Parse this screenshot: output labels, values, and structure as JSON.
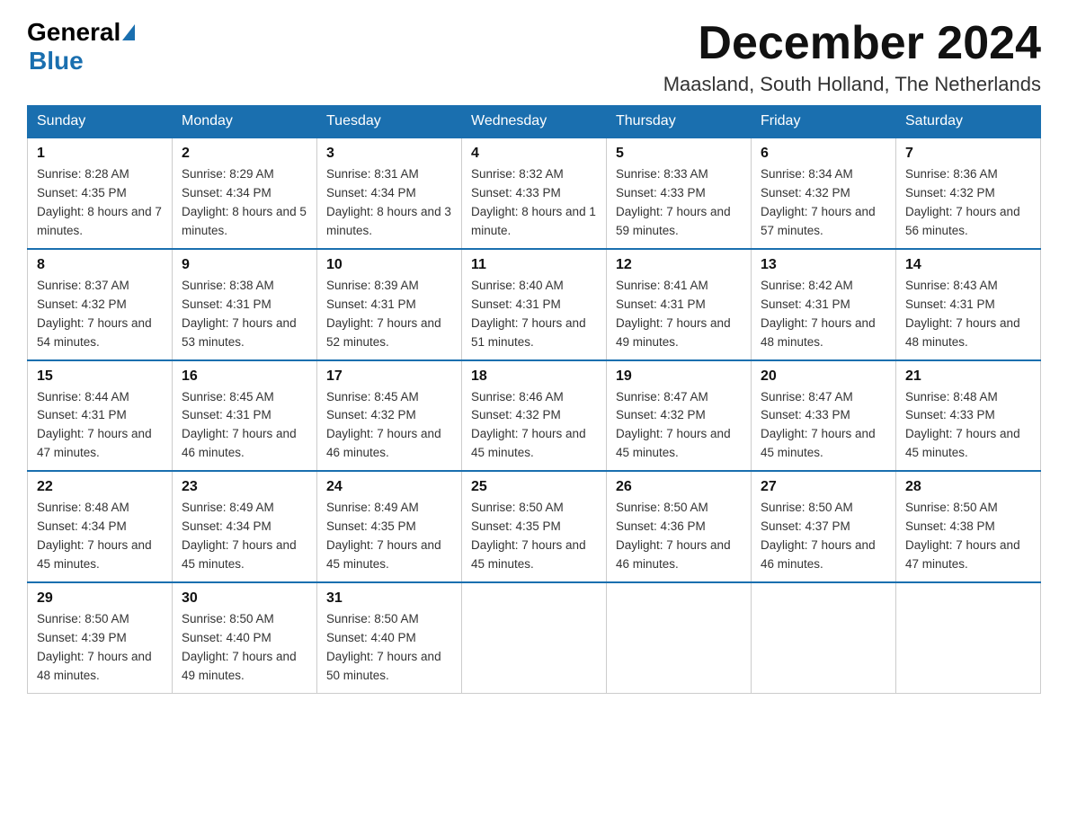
{
  "header": {
    "logo_general": "General",
    "logo_blue": "Blue",
    "month_year": "December 2024",
    "location": "Maasland, South Holland, The Netherlands"
  },
  "days_of_week": [
    "Sunday",
    "Monday",
    "Tuesday",
    "Wednesday",
    "Thursday",
    "Friday",
    "Saturday"
  ],
  "weeks": [
    [
      {
        "day": "1",
        "sunrise": "8:28 AM",
        "sunset": "4:35 PM",
        "daylight": "8 hours and 7 minutes."
      },
      {
        "day": "2",
        "sunrise": "8:29 AM",
        "sunset": "4:34 PM",
        "daylight": "8 hours and 5 minutes."
      },
      {
        "day": "3",
        "sunrise": "8:31 AM",
        "sunset": "4:34 PM",
        "daylight": "8 hours and 3 minutes."
      },
      {
        "day": "4",
        "sunrise": "8:32 AM",
        "sunset": "4:33 PM",
        "daylight": "8 hours and 1 minute."
      },
      {
        "day": "5",
        "sunrise": "8:33 AM",
        "sunset": "4:33 PM",
        "daylight": "7 hours and 59 minutes."
      },
      {
        "day": "6",
        "sunrise": "8:34 AM",
        "sunset": "4:32 PM",
        "daylight": "7 hours and 57 minutes."
      },
      {
        "day": "7",
        "sunrise": "8:36 AM",
        "sunset": "4:32 PM",
        "daylight": "7 hours and 56 minutes."
      }
    ],
    [
      {
        "day": "8",
        "sunrise": "8:37 AM",
        "sunset": "4:32 PM",
        "daylight": "7 hours and 54 minutes."
      },
      {
        "day": "9",
        "sunrise": "8:38 AM",
        "sunset": "4:31 PM",
        "daylight": "7 hours and 53 minutes."
      },
      {
        "day": "10",
        "sunrise": "8:39 AM",
        "sunset": "4:31 PM",
        "daylight": "7 hours and 52 minutes."
      },
      {
        "day": "11",
        "sunrise": "8:40 AM",
        "sunset": "4:31 PM",
        "daylight": "7 hours and 51 minutes."
      },
      {
        "day": "12",
        "sunrise": "8:41 AM",
        "sunset": "4:31 PM",
        "daylight": "7 hours and 49 minutes."
      },
      {
        "day": "13",
        "sunrise": "8:42 AM",
        "sunset": "4:31 PM",
        "daylight": "7 hours and 48 minutes."
      },
      {
        "day": "14",
        "sunrise": "8:43 AM",
        "sunset": "4:31 PM",
        "daylight": "7 hours and 48 minutes."
      }
    ],
    [
      {
        "day": "15",
        "sunrise": "8:44 AM",
        "sunset": "4:31 PM",
        "daylight": "7 hours and 47 minutes."
      },
      {
        "day": "16",
        "sunrise": "8:45 AM",
        "sunset": "4:31 PM",
        "daylight": "7 hours and 46 minutes."
      },
      {
        "day": "17",
        "sunrise": "8:45 AM",
        "sunset": "4:32 PM",
        "daylight": "7 hours and 46 minutes."
      },
      {
        "day": "18",
        "sunrise": "8:46 AM",
        "sunset": "4:32 PM",
        "daylight": "7 hours and 45 minutes."
      },
      {
        "day": "19",
        "sunrise": "8:47 AM",
        "sunset": "4:32 PM",
        "daylight": "7 hours and 45 minutes."
      },
      {
        "day": "20",
        "sunrise": "8:47 AM",
        "sunset": "4:33 PM",
        "daylight": "7 hours and 45 minutes."
      },
      {
        "day": "21",
        "sunrise": "8:48 AM",
        "sunset": "4:33 PM",
        "daylight": "7 hours and 45 minutes."
      }
    ],
    [
      {
        "day": "22",
        "sunrise": "8:48 AM",
        "sunset": "4:34 PM",
        "daylight": "7 hours and 45 minutes."
      },
      {
        "day": "23",
        "sunrise": "8:49 AM",
        "sunset": "4:34 PM",
        "daylight": "7 hours and 45 minutes."
      },
      {
        "day": "24",
        "sunrise": "8:49 AM",
        "sunset": "4:35 PM",
        "daylight": "7 hours and 45 minutes."
      },
      {
        "day": "25",
        "sunrise": "8:50 AM",
        "sunset": "4:35 PM",
        "daylight": "7 hours and 45 minutes."
      },
      {
        "day": "26",
        "sunrise": "8:50 AM",
        "sunset": "4:36 PM",
        "daylight": "7 hours and 46 minutes."
      },
      {
        "day": "27",
        "sunrise": "8:50 AM",
        "sunset": "4:37 PM",
        "daylight": "7 hours and 46 minutes."
      },
      {
        "day": "28",
        "sunrise": "8:50 AM",
        "sunset": "4:38 PM",
        "daylight": "7 hours and 47 minutes."
      }
    ],
    [
      {
        "day": "29",
        "sunrise": "8:50 AM",
        "sunset": "4:39 PM",
        "daylight": "7 hours and 48 minutes."
      },
      {
        "day": "30",
        "sunrise": "8:50 AM",
        "sunset": "4:40 PM",
        "daylight": "7 hours and 49 minutes."
      },
      {
        "day": "31",
        "sunrise": "8:50 AM",
        "sunset": "4:40 PM",
        "daylight": "7 hours and 50 minutes."
      },
      null,
      null,
      null,
      null
    ]
  ]
}
